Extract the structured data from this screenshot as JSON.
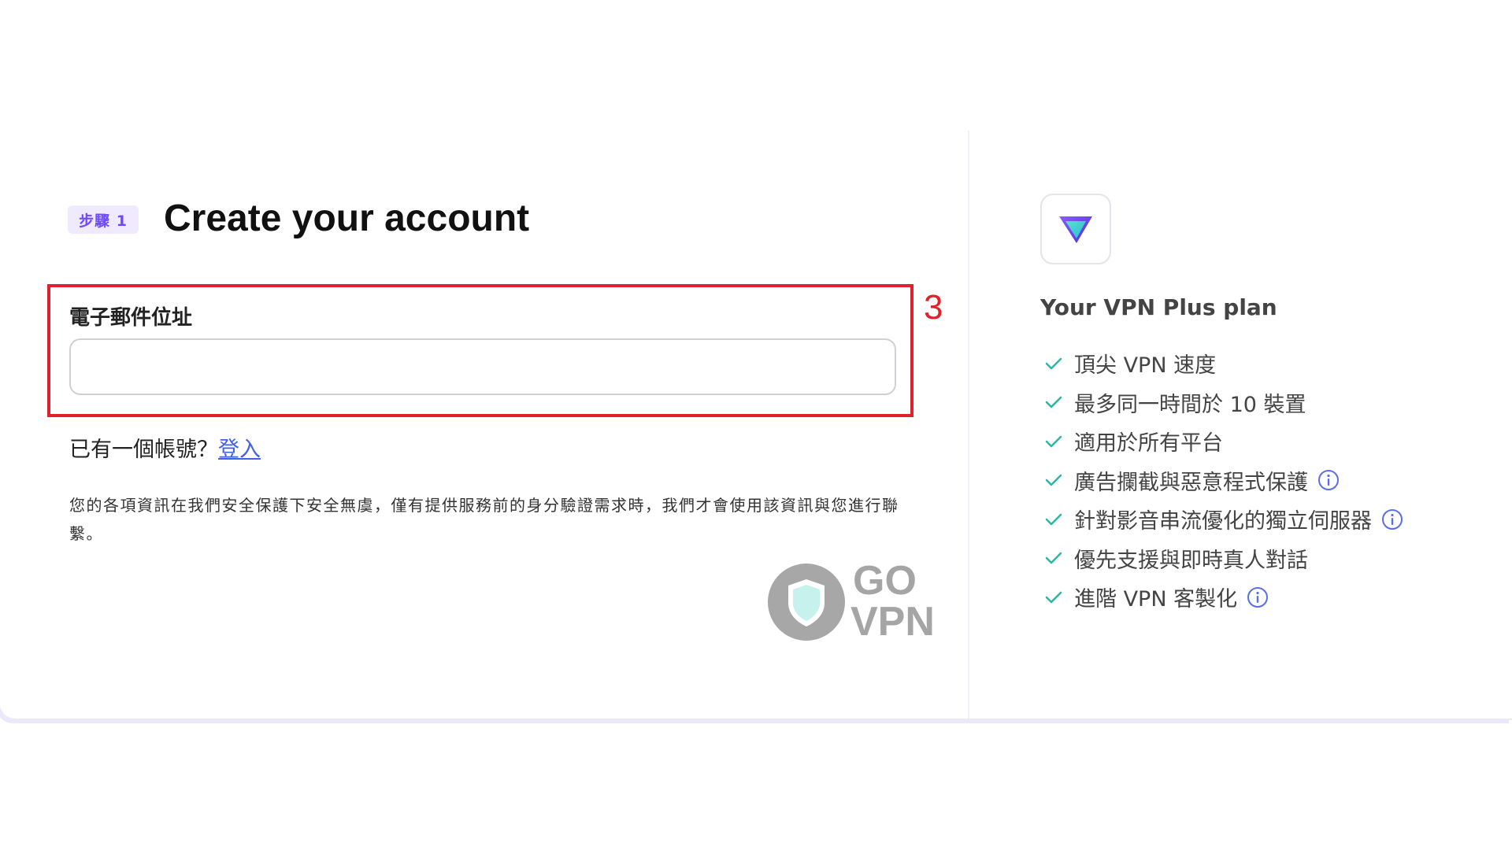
{
  "header": {
    "step_badge": "步驟 1",
    "title": "Create your account"
  },
  "form": {
    "email_label": "電子郵件位址",
    "email_value": "",
    "have_account_text": "已有一個帳號？",
    "login_link": "登入",
    "privacy_text": "您的各項資訊在我們安全保護下安全無虞，僅有提供服務前的身分驗證需求時，我們才會使用該資訊與您進行聯繫。"
  },
  "annotation": {
    "number": "3",
    "color": "#e0202b"
  },
  "watermark": {
    "line1": "GO",
    "line2": "VPN"
  },
  "plan": {
    "title": "Your VPN Plus plan",
    "features": [
      {
        "label": "頂尖 VPN 速度",
        "info": false
      },
      {
        "label": "最多同一時間於 10 裝置",
        "info": false
      },
      {
        "label": "適用於所有平台",
        "info": false
      },
      {
        "label": "廣告攔截與惡意程式保護",
        "info": true
      },
      {
        "label": "針對影音串流優化的獨立伺服器",
        "info": true
      },
      {
        "label": "優先支援與即時真人對話",
        "info": false
      },
      {
        "label": "進階 VPN 客製化",
        "info": true
      }
    ]
  },
  "colors": {
    "accent": "#6d4aff",
    "link": "#4161e6",
    "check": "#2bb8a2",
    "info": "#5b6ee8"
  }
}
